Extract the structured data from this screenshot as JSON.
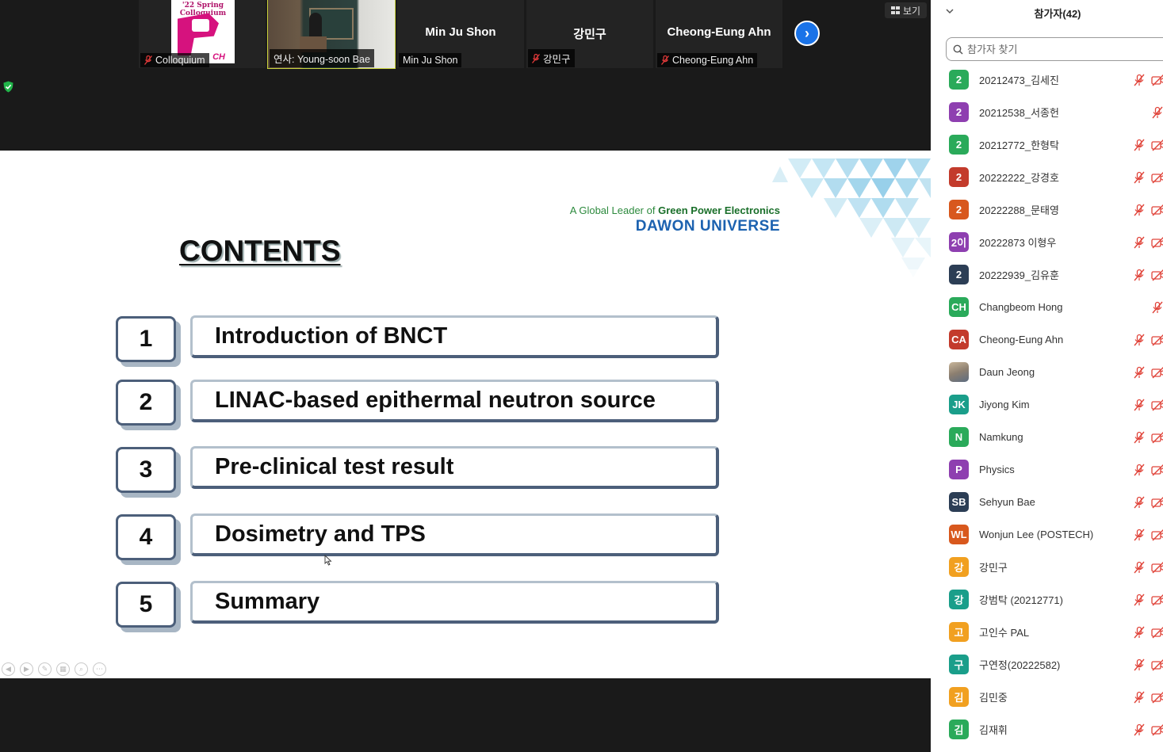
{
  "video_strip": {
    "tiles": [
      {
        "label": "Colloquium",
        "muted": true,
        "logo_text": "'22 Spring Colloquium",
        "logo_suffix": "CH"
      },
      {
        "label": "연사: Young-soon Bae",
        "muted": false
      },
      {
        "center_name": "Min Ju Shon",
        "label": "Min Ju Shon",
        "muted": false
      },
      {
        "center_name": "강민구",
        "label": "강민구",
        "muted": true
      },
      {
        "center_name": "Cheong-Eung Ahn",
        "label": "Cheong-Eung Ahn",
        "muted": true
      }
    ],
    "view_button_label": "보기"
  },
  "slide": {
    "tagline_prefix": "A Global Leader of ",
    "tagline_bold": "Green Power Electronics",
    "brand": "DAWON UNIVERSE",
    "title": "CONTENTS",
    "items": [
      {
        "num": "1",
        "text": "Introduction of BNCT"
      },
      {
        "num": "2",
        "text": "LINAC-based epithermal neutron source"
      },
      {
        "num": "3",
        "text": "Pre-clinical test result"
      },
      {
        "num": "4",
        "text": "Dosimetry and TPS"
      },
      {
        "num": "5",
        "text": "Summary"
      }
    ]
  },
  "participants": {
    "title": "참가자(42)",
    "search_placeholder": "참가자 찾기",
    "list": [
      {
        "avatar": "2",
        "color": "#2aaa5a",
        "name": "20212473_김세진",
        "icons": "both"
      },
      {
        "avatar": "2",
        "color": "#8e3fb0",
        "name": "20212538_서종헌",
        "icons": "mic"
      },
      {
        "avatar": "2",
        "color": "#2aaa5a",
        "name": "20212772_한형탁",
        "icons": "both"
      },
      {
        "avatar": "2",
        "color": "#c33b2c",
        "name": "20222222_강경호",
        "icons": "both"
      },
      {
        "avatar": "2",
        "color": "#d8581d",
        "name": "20222288_문태영",
        "icons": "both"
      },
      {
        "avatar": "2이",
        "color": "#8e3fb0",
        "name": "20222873 이형우",
        "icons": "both"
      },
      {
        "avatar": "2",
        "color": "#2c3e55",
        "name": "20222939_김유훈",
        "icons": "both"
      },
      {
        "avatar": "CH",
        "color": "#2aaa5a",
        "name": "Changbeom Hong",
        "icons": "mic"
      },
      {
        "avatar": "CA",
        "color": "#c33b2c",
        "name": "Cheong-Eung Ahn",
        "icons": "both"
      },
      {
        "avatar": "",
        "color": "photo",
        "name": "Daun Jeong",
        "icons": "both"
      },
      {
        "avatar": "JK",
        "color": "#1a9e8a",
        "name": "Jiyong Kim",
        "icons": "both"
      },
      {
        "avatar": "N",
        "color": "#2aaa5a",
        "name": "Namkung",
        "icons": "both"
      },
      {
        "avatar": "P",
        "color": "#8e3fb0",
        "name": "Physics",
        "icons": "both"
      },
      {
        "avatar": "SB",
        "color": "#2c3e55",
        "name": "Sehyun Bae",
        "icons": "both"
      },
      {
        "avatar": "WL",
        "color": "#d8581d",
        "name": "Wonjun Lee (POSTECH)",
        "icons": "both"
      },
      {
        "avatar": "강",
        "color": "#f1a020",
        "name": "강민구",
        "icons": "both"
      },
      {
        "avatar": "강",
        "color": "#1a9e8a",
        "name": "강범탁 (20212771)",
        "icons": "both"
      },
      {
        "avatar": "고",
        "color": "#f1a020",
        "name": "고인수 PAL",
        "icons": "both"
      },
      {
        "avatar": "구",
        "color": "#1a9e8a",
        "name": "구연정(20222582)",
        "icons": "both"
      },
      {
        "avatar": "김",
        "color": "#f1a020",
        "name": "김민중",
        "icons": "both"
      },
      {
        "avatar": "김",
        "color": "#2aaa5a",
        "name": "김재휘",
        "icons": "both"
      }
    ]
  }
}
